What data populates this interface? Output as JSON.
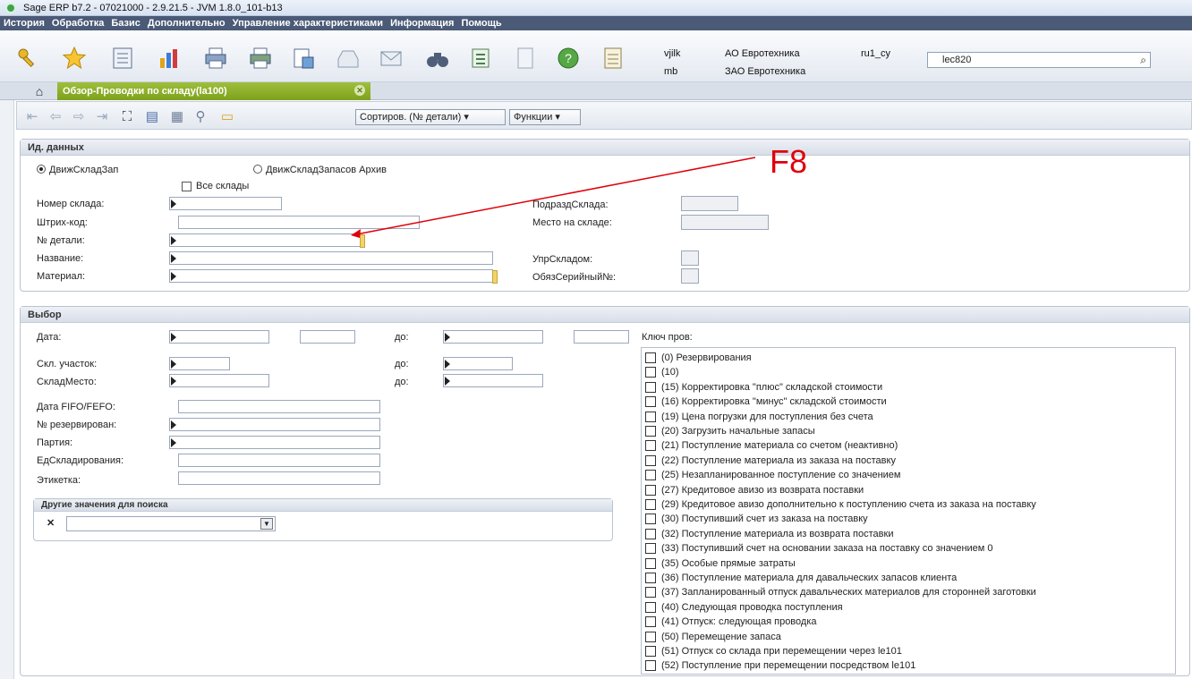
{
  "window": {
    "title": "Sage ERP b7.2 - 07021000 - 2.9.21.5 - JVM 1.8.0_101-b13"
  },
  "menu": [
    {
      "label": "История"
    },
    {
      "label": "Обработка"
    },
    {
      "label": "Базис"
    },
    {
      "label": "Дополнительно"
    },
    {
      "label": "Управление характеристиками"
    },
    {
      "label": "Информация"
    },
    {
      "label": "Помощь"
    }
  ],
  "header": {
    "user1": "vjilk",
    "user2": "mb",
    "company1": "АО Евротехника",
    "company2": "ЗАО Евротехника",
    "locale": "ru1_cy",
    "combo_value": "lec820"
  },
  "tab": {
    "label": "Обзор-Проводки по складу(la100)"
  },
  "subtoolbar": {
    "sort_label": "Сортиров. (№ детали) ▾",
    "functions_label": "Функции ▾"
  },
  "data_panel": {
    "header": "Ид. данных",
    "radio1": "ДвижСкладЗап",
    "radio2": "ДвижСкладЗапасов Архив",
    "all_warehouses": "Все склады",
    "labels": {
      "warehouse_no": "Номер склада:",
      "barcode": "Штрих-код:",
      "part_no": "№ детали:",
      "name": "Название:",
      "material": "Материал:",
      "subdivision": "ПодраздСклада:",
      "location": "Место на складе:",
      "warehouse_mgmt": "УпрСкладом:",
      "serial_required": "ОбязСерийный№:"
    }
  },
  "annotation": {
    "label": "F8"
  },
  "selection_panel": {
    "header": "Выбор",
    "labels": {
      "date": "Дата:",
      "to": "до:",
      "section": "Скл. участок:",
      "place": "СкладМесто:",
      "fifo_date": "Дата FIFO/FEFO:",
      "reservation": "№ резервирован:",
      "batch": "Партия:",
      "unit": "ЕдСкладирования:",
      "label": "Этикетка:",
      "key": "Ключ пров:"
    },
    "other_values_header": "Другие значения для поиска",
    "keys": [
      "(0)  Резервирования",
      "(10)",
      "(15)  Корректировка \"плюс\" складской стоимости",
      "(16)  Корректировка \"минус\" складской стоимости",
      "(19)  Цена погрузки для поступления без счета",
      "(20)  Загрузить начальные запасы",
      "(21)  Поступление материала со счетом (неактивно)",
      "(22)  Поступление материала из заказа на поставку",
      "(25)  Незапланированное поступление со значением",
      "(27)  Кредитовое авизо из возврата поставки",
      "(29)  Кредитовое авизо дополнительно к поступлению счета из заказа на поставку",
      "(30)  Поступивший счет из заказа на поставку",
      "(32)  Поступление материала из возврата поставки",
      "(33)  Поступивший счет на основании заказа на поставку со значением 0",
      "(35)  Особые прямые затраты",
      "(36)  Поступление материала для давальческих запасов клиента",
      "(37)  Запланированный отпуск давальческих материалов для сторонней заготовки",
      "(40)  Следующая проводка поступления",
      "(41)  Отпуск: следующая проводка",
      "(50)  Перемещение запаса",
      "(51)  Отпуск со склада при перемещении через le101",
      "(52)  Поступление при перемещении посредством le101"
    ]
  }
}
